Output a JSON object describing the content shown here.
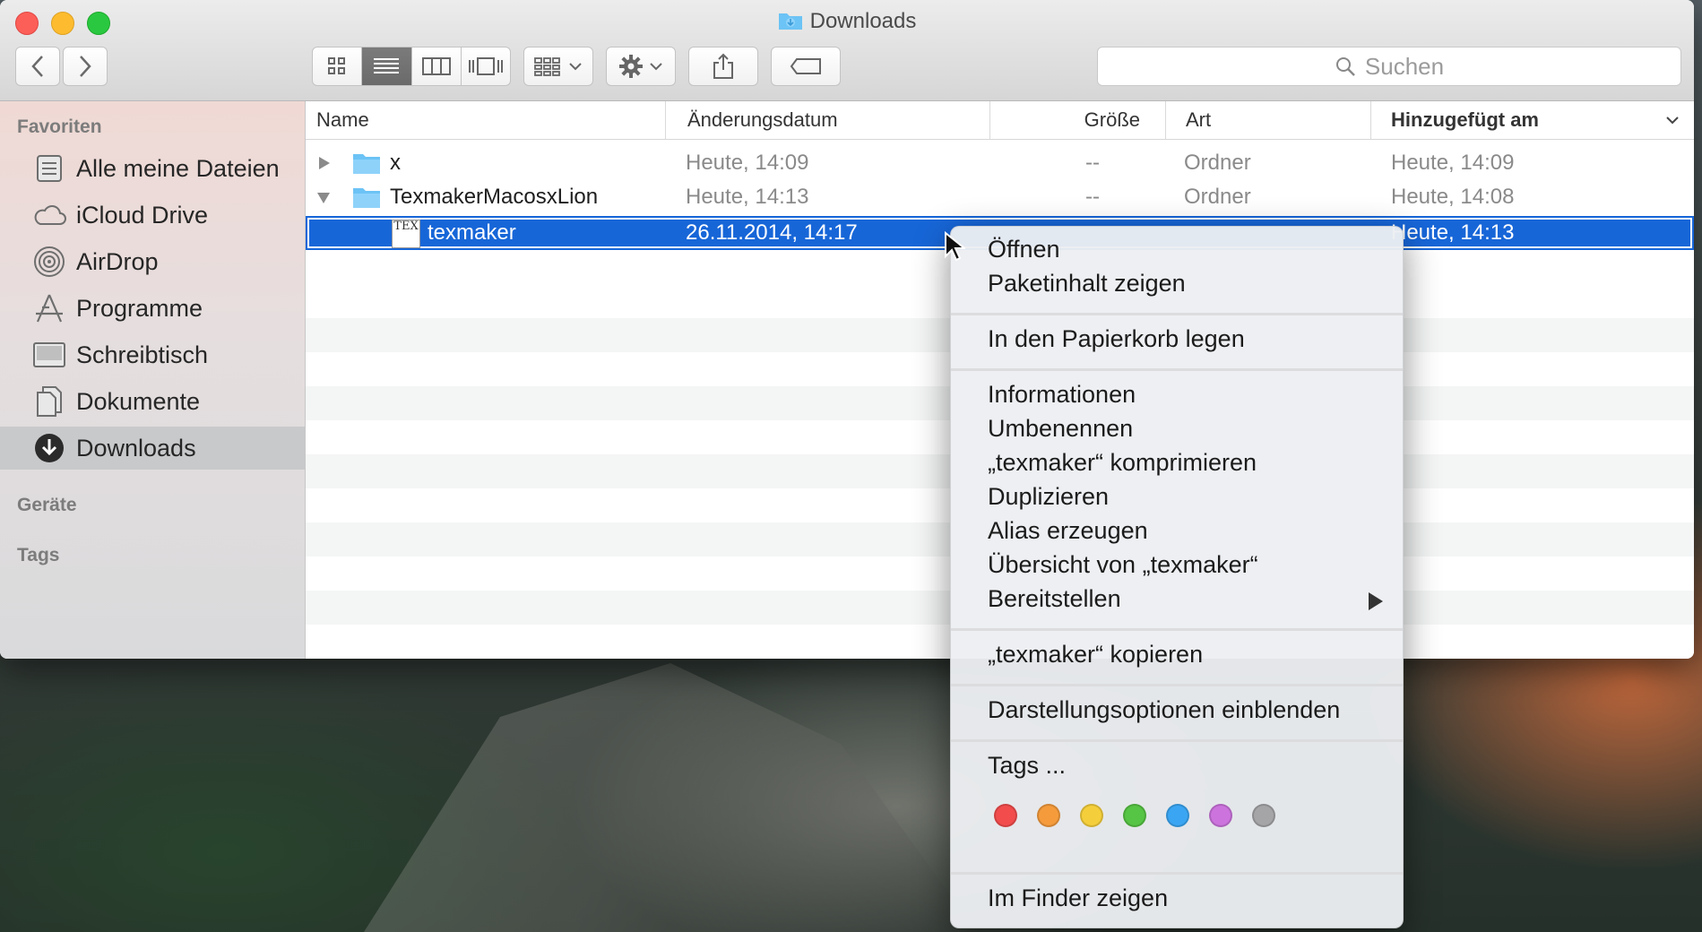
{
  "window": {
    "title": "Downloads"
  },
  "toolbar": {
    "back": "back",
    "forward": "forward",
    "view_modes": [
      "icon-view",
      "list-view",
      "column-view",
      "cover-flow-view"
    ],
    "active_view": "list-view",
    "search_placeholder": "Suchen"
  },
  "sidebar": {
    "favorites_heading": "Favoriten",
    "items": [
      {
        "label": "Alle meine Dateien",
        "icon": "all-files-icon"
      },
      {
        "label": "iCloud Drive",
        "icon": "cloud-icon"
      },
      {
        "label": "AirDrop",
        "icon": "airdrop-icon"
      },
      {
        "label": "Programme",
        "icon": "applications-icon"
      },
      {
        "label": "Schreibtisch",
        "icon": "desktop-icon"
      },
      {
        "label": "Dokumente",
        "icon": "documents-icon"
      },
      {
        "label": "Downloads",
        "icon": "downloads-icon",
        "active": true
      }
    ],
    "devices_heading": "Geräte",
    "tags_heading": "Tags"
  },
  "list": {
    "columns": {
      "name": "Name",
      "modified": "Änderungsdatum",
      "size": "Größe",
      "kind": "Art",
      "added": "Hinzugefügt am"
    },
    "rows": [
      {
        "name": "x",
        "modified": "Heute, 14:09",
        "size": "--",
        "kind": "Ordner",
        "added": "Heute, 14:09",
        "disclosure": "collapsed"
      },
      {
        "name": "TexmakerMacosxLion",
        "modified": "Heute, 14:13",
        "size": "--",
        "kind": "Ordner",
        "added": "Heute, 14:08",
        "disclosure": "expanded"
      },
      {
        "name": "texmaker",
        "modified": "26.11.2014, 14:17",
        "size": "",
        "kind": "",
        "added": "Heute, 14:13",
        "selected": true
      }
    ],
    "file_icon_text": "TEX"
  },
  "context_menu": {
    "group1": [
      "Öffnen",
      "Paketinhalt zeigen"
    ],
    "group2": [
      "In den Papierkorb legen"
    ],
    "group3": [
      "Informationen",
      "Umbenennen",
      "„texmaker“ komprimieren",
      "Duplizieren",
      "Alias erzeugen",
      "Übersicht von „texmaker“",
      "Bereitstellen"
    ],
    "group4": [
      "„texmaker“ kopieren"
    ],
    "group5": [
      "Darstellungsoptionen einblenden"
    ],
    "group6": [
      "Tags ..."
    ],
    "group7": [
      "Im Finder zeigen"
    ],
    "tag_colors": [
      "#f24c4c",
      "#f59b3b",
      "#f5cf3b",
      "#56c444",
      "#3aa6f3",
      "#cc73dd",
      "#a5a5a7"
    ]
  }
}
